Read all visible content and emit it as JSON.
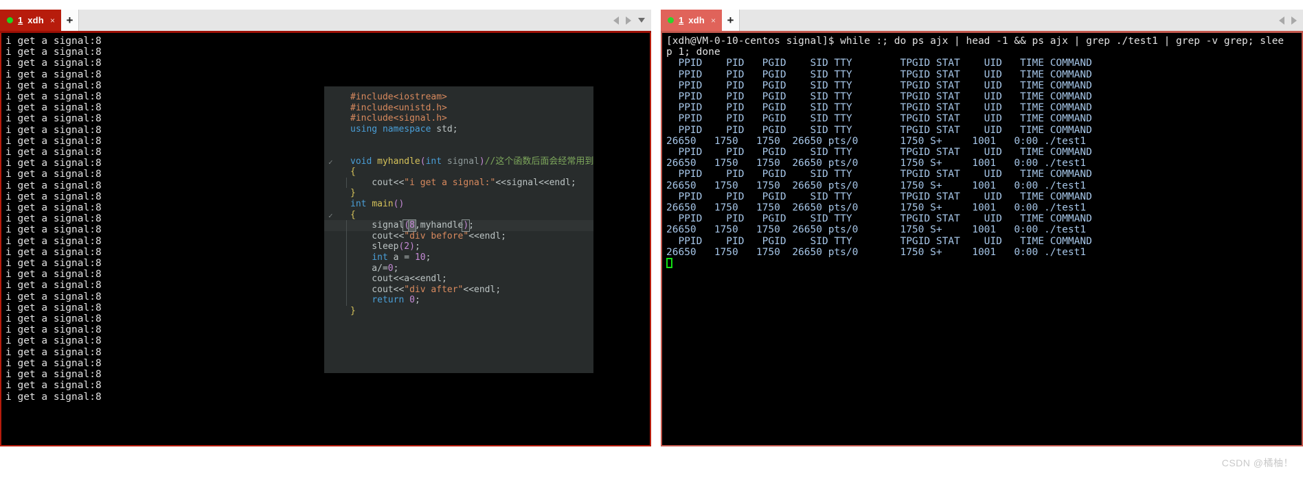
{
  "left_window": {
    "tab": {
      "number": "1",
      "title": "xdh",
      "close": "×",
      "dot": "green-status-dot"
    },
    "new_tab_label": "+",
    "nav": {
      "left": "◀",
      "right": "▶",
      "down": "▾"
    },
    "output_line": "i get a signal:8",
    "output_line_count": 33
  },
  "right_window": {
    "tab": {
      "number": "1",
      "title": "xdh",
      "close": "×",
      "dot": "green-status-dot"
    },
    "new_tab_label": "+",
    "nav": {
      "left": "◀",
      "right": "▶"
    },
    "prompt_line_1": "[xdh@VM-0-10-centos signal]$ while :; do ps ajx | head -1 && ps ajx | grep ./test1 | grep -v grep; slee",
    "prompt_line_2": "p 1; done",
    "header_row": "  PPID    PID   PGID    SID TTY        TPGID STAT    UID   TIME COMMAND",
    "process_row": "26650   1750   1750  26650 pts/0       1750 S+     1001   0:00 ./test1",
    "lines": [
      {
        "type": "prompt",
        "text": "[xdh@VM-0-10-centos signal]$ while :; do ps ajx | head -1 && ps ajx | grep ./test1 | grep -v grep; slee"
      },
      {
        "type": "prompt",
        "text": "p 1; done"
      },
      {
        "type": "header",
        "text": "  PPID    PID   PGID    SID TTY        TPGID STAT    UID   TIME COMMAND"
      },
      {
        "type": "header",
        "text": "  PPID    PID   PGID    SID TTY        TPGID STAT    UID   TIME COMMAND"
      },
      {
        "type": "header",
        "text": "  PPID    PID   PGID    SID TTY        TPGID STAT    UID   TIME COMMAND"
      },
      {
        "type": "header",
        "text": "  PPID    PID   PGID    SID TTY        TPGID STAT    UID   TIME COMMAND"
      },
      {
        "type": "header",
        "text": "  PPID    PID   PGID    SID TTY        TPGID STAT    UID   TIME COMMAND"
      },
      {
        "type": "header",
        "text": "  PPID    PID   PGID    SID TTY        TPGID STAT    UID   TIME COMMAND"
      },
      {
        "type": "header",
        "text": "  PPID    PID   PGID    SID TTY        TPGID STAT    UID   TIME COMMAND"
      },
      {
        "type": "proc",
        "text": "26650   1750   1750  26650 pts/0       1750 S+     1001   0:00 ./test1"
      },
      {
        "type": "header",
        "text": "  PPID    PID   PGID    SID TTY        TPGID STAT    UID   TIME COMMAND"
      },
      {
        "type": "proc",
        "text": "26650   1750   1750  26650 pts/0       1750 S+     1001   0:00 ./test1"
      },
      {
        "type": "header",
        "text": "  PPID    PID   PGID    SID TTY        TPGID STAT    UID   TIME COMMAND"
      },
      {
        "type": "proc",
        "text": "26650   1750   1750  26650 pts/0       1750 S+     1001   0:00 ./test1"
      },
      {
        "type": "header",
        "text": "  PPID    PID   PGID    SID TTY        TPGID STAT    UID   TIME COMMAND"
      },
      {
        "type": "proc",
        "text": "26650   1750   1750  26650 pts/0       1750 S+     1001   0:00 ./test1"
      },
      {
        "type": "header",
        "text": "  PPID    PID   PGID    SID TTY        TPGID STAT    UID   TIME COMMAND"
      },
      {
        "type": "proc",
        "text": "26650   1750   1750  26650 pts/0       1750 S+     1001   0:00 ./test1"
      },
      {
        "type": "header",
        "text": "  PPID    PID   PGID    SID TTY        TPGID STAT    UID   TIME COMMAND"
      },
      {
        "type": "proc",
        "text": "26650   1750   1750  26650 pts/0       1750 S+     1001   0:00 ./test1"
      }
    ]
  },
  "code_editor": {
    "filetype": "cpp",
    "lines": [
      {
        "id": "l1",
        "tokens": [
          {
            "c": "t-pre",
            "t": "#include<iostream>"
          }
        ]
      },
      {
        "id": "l2",
        "tokens": [
          {
            "c": "t-pre",
            "t": "#include<unistd.h>"
          }
        ]
      },
      {
        "id": "l3",
        "tokens": [
          {
            "c": "t-pre",
            "t": "#include<signal.h>"
          }
        ]
      },
      {
        "id": "l4",
        "tokens": [
          {
            "c": "t-kw",
            "t": "using"
          },
          {
            "c": "t-plain",
            "t": " "
          },
          {
            "c": "t-kw",
            "t": "namespace"
          },
          {
            "c": "t-plain",
            "t": " std;"
          }
        ]
      },
      {
        "id": "l5",
        "tokens": []
      },
      {
        "id": "l6",
        "tokens": []
      },
      {
        "id": "l7",
        "tokens": [
          {
            "c": "t-kw",
            "t": "void"
          },
          {
            "c": "t-plain",
            "t": " "
          },
          {
            "c": "t-fn",
            "t": "myhandle"
          },
          {
            "c": "t-paren",
            "t": "("
          },
          {
            "c": "t-type",
            "t": "int"
          },
          {
            "c": "t-plain",
            "t": " "
          },
          {
            "c": "t-param",
            "t": "signal"
          },
          {
            "c": "t-paren",
            "t": ")"
          },
          {
            "c": "t-cmt",
            "t": "//这个函数后面会经常用到"
          }
        ],
        "fold": "✓"
      },
      {
        "id": "l8",
        "tokens": [
          {
            "c": "t-brace",
            "t": "{"
          }
        ]
      },
      {
        "id": "l9",
        "tokens": [
          {
            "c": "t-plain",
            "t": "    cout<<"
          },
          {
            "c": "t-str",
            "t": "\"i get a signal:\""
          },
          {
            "c": "t-plain",
            "t": "<<signal<<endl;"
          }
        ],
        "guide": true
      },
      {
        "id": "l10",
        "tokens": [
          {
            "c": "t-brace",
            "t": "}"
          }
        ]
      },
      {
        "id": "l11",
        "tokens": [
          {
            "c": "t-type",
            "t": "int"
          },
          {
            "c": "t-plain",
            "t": " "
          },
          {
            "c": "t-fn",
            "t": "main"
          },
          {
            "c": "t-paren",
            "t": "()"
          }
        ]
      },
      {
        "id": "l12",
        "tokens": [
          {
            "c": "t-brace",
            "t": "{"
          }
        ],
        "fold": "✓"
      },
      {
        "id": "l13",
        "tokens": [
          {
            "c": "t-plain",
            "t": "    signal"
          },
          {
            "c": "t-paren paren-match",
            "t": "("
          },
          {
            "c": "t-num caret-box",
            "t": "8"
          },
          {
            "c": "t-plain",
            "t": ",myhandle"
          },
          {
            "c": "t-paren paren-match",
            "t": ")"
          },
          {
            "c": "t-plain",
            "t": ";"
          }
        ],
        "highlight": true,
        "guide": true
      },
      {
        "id": "l14",
        "tokens": [
          {
            "c": "t-plain",
            "t": "    cout<<"
          },
          {
            "c": "t-str",
            "t": "\"div before\""
          },
          {
            "c": "t-plain",
            "t": "<<endl;"
          }
        ],
        "guide": true
      },
      {
        "id": "l15",
        "tokens": [
          {
            "c": "t-plain",
            "t": "    sleep"
          },
          {
            "c": "t-paren",
            "t": "("
          },
          {
            "c": "t-num",
            "t": "2"
          },
          {
            "c": "t-paren",
            "t": ")"
          },
          {
            "c": "t-plain",
            "t": ";"
          }
        ],
        "guide": true
      },
      {
        "id": "l16",
        "tokens": [
          {
            "c": "t-plain",
            "t": "    "
          },
          {
            "c": "t-type",
            "t": "int"
          },
          {
            "c": "t-plain",
            "t": " a = "
          },
          {
            "c": "t-num",
            "t": "10"
          },
          {
            "c": "t-plain",
            "t": ";"
          }
        ],
        "guide": true
      },
      {
        "id": "l17",
        "tokens": [
          {
            "c": "t-plain",
            "t": "    a/="
          },
          {
            "c": "t-num",
            "t": "0"
          },
          {
            "c": "t-plain",
            "t": ";"
          }
        ],
        "guide": true
      },
      {
        "id": "l18",
        "tokens": [
          {
            "c": "t-plain",
            "t": "    cout<<a<<endl;"
          }
        ],
        "guide": true
      },
      {
        "id": "l19",
        "tokens": [
          {
            "c": "t-plain",
            "t": "    cout<<"
          },
          {
            "c": "t-str",
            "t": "\"div after\""
          },
          {
            "c": "t-plain",
            "t": "<<endl;"
          }
        ],
        "guide": true
      },
      {
        "id": "l20",
        "tokens": [
          {
            "c": "t-plain",
            "t": "    "
          },
          {
            "c": "t-kw",
            "t": "return"
          },
          {
            "c": "t-plain",
            "t": " "
          },
          {
            "c": "t-num",
            "t": "0"
          },
          {
            "c": "t-plain",
            "t": ";"
          }
        ],
        "guide": true
      },
      {
        "id": "l21",
        "tokens": [
          {
            "c": "t-brace",
            "t": "}"
          }
        ]
      }
    ]
  },
  "watermark": {
    "text": "CSDN @橘柚！"
  },
  "colors": {
    "tab_red": "#b71c0c",
    "tab_red_light": "#e0635a",
    "terminal_bg": "#000000",
    "editor_bg": "#282c2c",
    "status_dot_green": "#1fd31f",
    "cursor_green": "#13e113"
  }
}
